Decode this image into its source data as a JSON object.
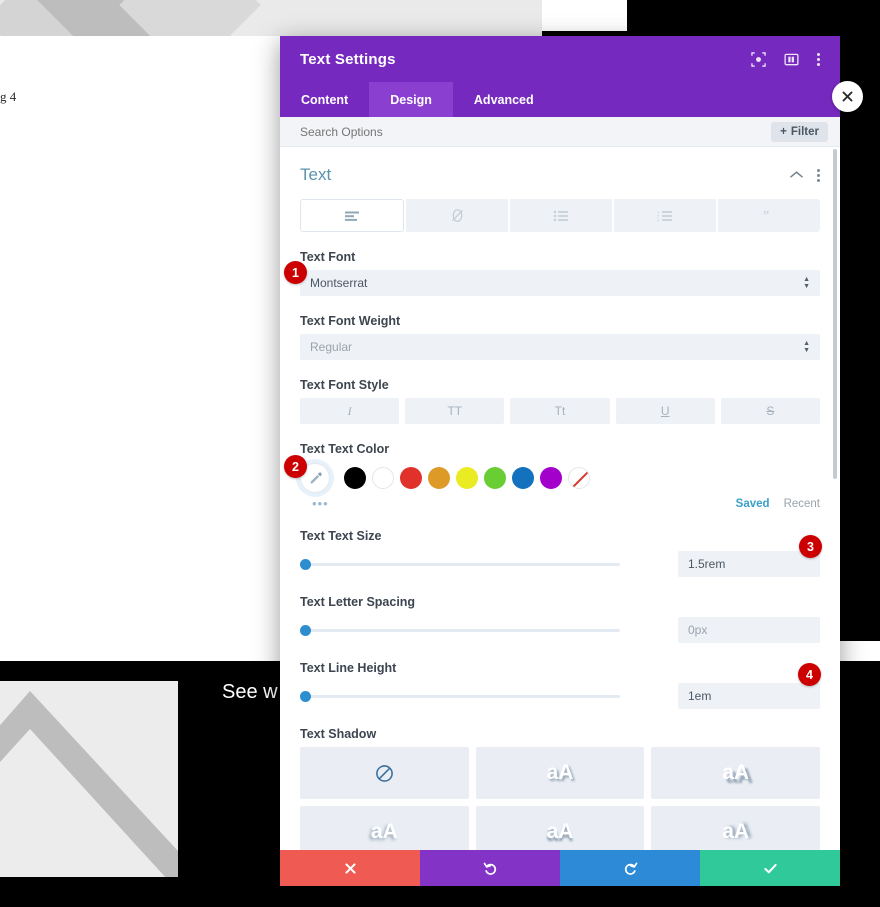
{
  "background": {
    "caption": "g 4",
    "headline": "See w",
    "image_alt": "placeholder-image"
  },
  "modal": {
    "title": "Text Settings",
    "header_icons": [
      "focus-target-icon",
      "layout-columns-icon",
      "more-vertical-icon"
    ],
    "tabs": [
      {
        "label": "Content",
        "active": false
      },
      {
        "label": "Design",
        "active": true
      },
      {
        "label": "Advanced",
        "active": false
      }
    ],
    "search": {
      "placeholder": "Search Options",
      "value": "",
      "filter_label": "Filter"
    },
    "section": {
      "title": "Text",
      "collapse_icon": "chevron-up-icon",
      "menu_icon": "more-vertical-icon",
      "alignment_buttons": [
        {
          "icon": "paragraph-align-icon",
          "active": true
        },
        {
          "icon": "link-slash-icon",
          "active": false
        },
        {
          "icon": "unordered-list-icon",
          "active": false
        },
        {
          "icon": "ordered-list-icon",
          "active": false
        },
        {
          "icon": "blockquote-icon",
          "active": false
        }
      ]
    },
    "fields": {
      "text_font": {
        "label": "Text Font",
        "value": "Montserrat"
      },
      "text_font_weight": {
        "label": "Text Font Weight",
        "value": "Regular"
      },
      "text_font_style": {
        "label": "Text Font Style",
        "buttons": [
          {
            "label": "I",
            "name": "italic"
          },
          {
            "label": "TT",
            "name": "uppercase"
          },
          {
            "label": "Tt",
            "name": "capitalize"
          },
          {
            "label": "U",
            "name": "underline"
          },
          {
            "label": "S",
            "name": "strikethrough"
          }
        ]
      },
      "text_color": {
        "label": "Text Text Color",
        "eyedropper_icon": "eyedropper-icon",
        "swatches": [
          {
            "name": "black",
            "hex": "#000000"
          },
          {
            "name": "white",
            "hex": "#ffffff"
          },
          {
            "name": "red",
            "hex": "#e0322a"
          },
          {
            "name": "orange",
            "hex": "#dd9a27"
          },
          {
            "name": "yellow",
            "hex": "#ebeb24"
          },
          {
            "name": "green",
            "hex": "#69cd34"
          },
          {
            "name": "blue",
            "hex": "#1371bd"
          },
          {
            "name": "purple",
            "hex": "#a300cc"
          },
          {
            "name": "none",
            "hex": "transparent"
          }
        ],
        "more_label": "•••",
        "saved_label": "Saved",
        "recent_label": "Recent"
      },
      "text_size": {
        "label": "Text Text Size",
        "value": "1.5rem",
        "is_placeholder": false
      },
      "letter_spacing": {
        "label": "Text Letter Spacing",
        "value": "0px",
        "is_placeholder": true
      },
      "line_height": {
        "label": "Text Line Height",
        "value": "1em",
        "is_placeholder": false
      },
      "text_shadow": {
        "label": "Text Shadow",
        "options": [
          {
            "name": "none",
            "label": ""
          },
          {
            "name": "shadow-1",
            "label": "aA"
          },
          {
            "name": "shadow-2",
            "label": "aA"
          },
          {
            "name": "shadow-3",
            "label": "aA"
          },
          {
            "name": "shadow-4",
            "label": "aA"
          },
          {
            "name": "shadow-5",
            "label": "aA"
          }
        ]
      }
    },
    "footer": {
      "close": "close-icon",
      "undo": "undo-icon",
      "redo": "redo-icon",
      "save": "checkmark-icon"
    }
  },
  "annotations": [
    {
      "number": "1",
      "target": "text-font-select"
    },
    {
      "number": "2",
      "target": "eyedropper-button"
    },
    {
      "number": "3",
      "target": "text-size-value"
    },
    {
      "number": "4",
      "target": "line-height-value"
    }
  ],
  "colors": {
    "brand_purple": "#7629bf",
    "tab_active": "#8a3fd1",
    "badge_red": "#cc0000",
    "section_title": "#5b93ae"
  }
}
